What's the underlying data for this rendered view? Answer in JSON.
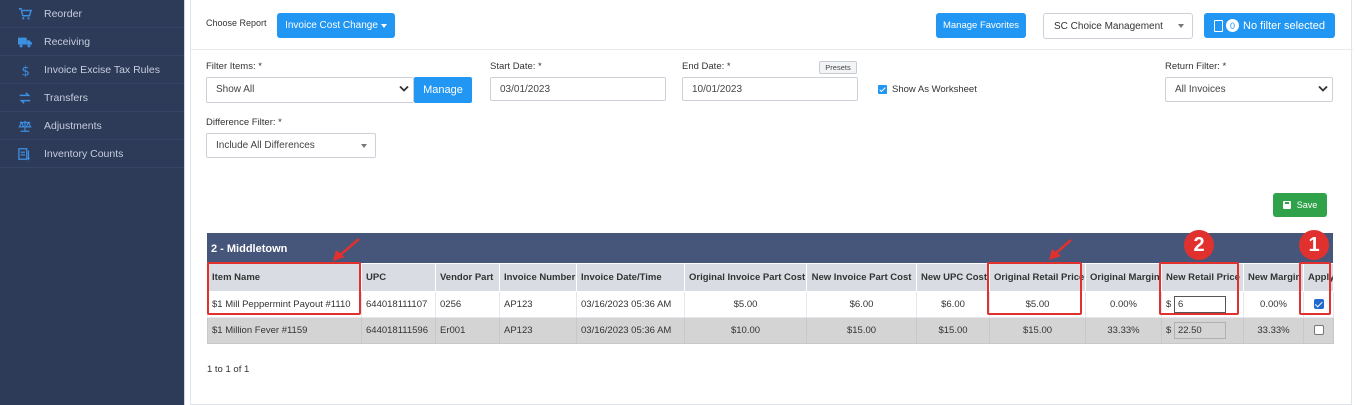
{
  "sidebar": {
    "items": [
      {
        "label": "Reorder",
        "icon": "cart-icon"
      },
      {
        "label": "Receiving",
        "icon": "truck-icon"
      },
      {
        "label": "Invoice Excise Tax Rules",
        "icon": "dollar-icon"
      },
      {
        "label": "Transfers",
        "icon": "transfer-arrows-icon"
      },
      {
        "label": "Adjustments",
        "icon": "balance-scale-icon"
      },
      {
        "label": "Inventory Counts",
        "icon": "clipboard-count-icon"
      }
    ]
  },
  "topbar": {
    "choose_report_label": "Choose Report",
    "report_button_label": "Invoice Cost Change",
    "manage_favorites_label": "Manage Favorites",
    "organization_value": "SC Choice Management",
    "filter_count": "0",
    "filter_label": "No filter selected"
  },
  "filters": {
    "filter_items_label": "Filter Items: *",
    "filter_items_value": "Show All",
    "manage_label": "Manage",
    "start_date_label": "Start Date: *",
    "start_date_value": "03/01/2023",
    "end_date_label": "End Date: *",
    "end_date_value": "10/01/2023",
    "presets_label": "Presets",
    "show_worksheet_label": "Show As Worksheet",
    "return_filter_label": "Return Filter: *",
    "return_filter_value": "All Invoices",
    "difference_filter_label": "Difference Filter: *",
    "difference_filter_value": "Include All Differences"
  },
  "save_label": "Save",
  "table": {
    "group_title": "2 - Middletown",
    "columns": [
      "Item Name",
      "UPC",
      "Vendor Part",
      "Invoice Number",
      "Invoice Date/Time",
      "Original Invoice Part Cost",
      "New Invoice Part Cost",
      "New UPC Cost",
      "Original Retail Price",
      "Original Margin",
      "New Retail Price",
      "New Margin",
      "Apply"
    ],
    "rows": [
      {
        "item_name": "$1 Mill Peppermint Payout #1110",
        "upc": "644018111107",
        "vendor_part": "0256",
        "invoice_number": "AP123",
        "invoice_datetime": "03/16/2023 05:36 AM",
        "orig_invoice_cost": "$5.00",
        "new_invoice_cost": "$6.00",
        "new_upc_cost": "$6.00",
        "orig_retail_price": "$5.00",
        "orig_margin": "0.00%",
        "currency": "$",
        "new_retail_price": "6",
        "new_margin": "0.00%",
        "apply": true
      },
      {
        "item_name": "$1 Million Fever #1159",
        "upc": "644018111596",
        "vendor_part": "Er001",
        "invoice_number": "AP123",
        "invoice_datetime": "03/16/2023 05:36 AM",
        "orig_invoice_cost": "$10.00",
        "new_invoice_cost": "$15.00",
        "new_upc_cost": "$15.00",
        "orig_retail_price": "$15.00",
        "orig_margin": "33.33%",
        "currency": "$",
        "new_retail_price": "22.50",
        "new_margin": "33.33%",
        "apply": false
      }
    ]
  },
  "pager_text": "1 to 1 of 1",
  "annotations": {
    "badge_1": "1",
    "badge_2": "2",
    "color": "#e0312f"
  }
}
